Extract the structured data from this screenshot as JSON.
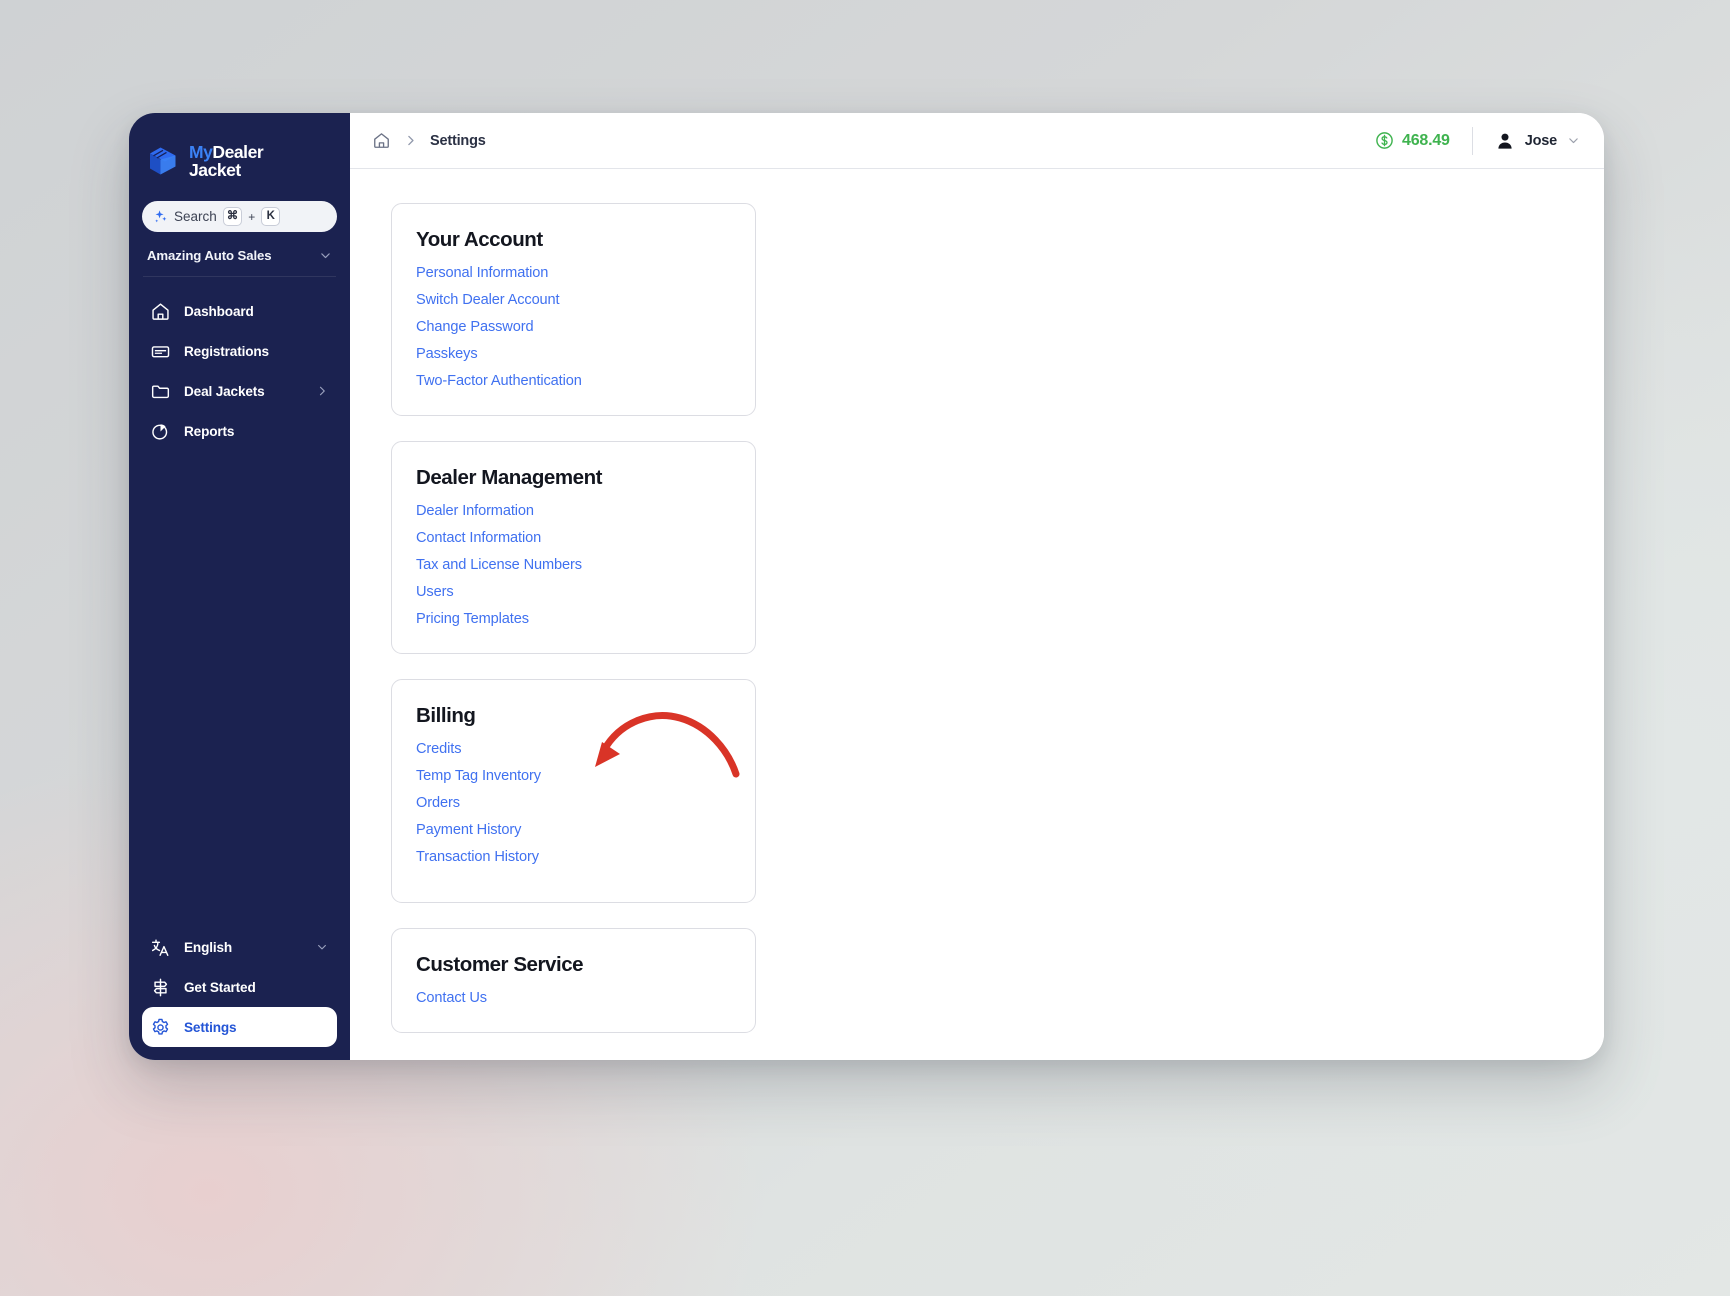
{
  "app": {
    "logo": {
      "line1_accent": "My",
      "line1_rest": "Dealer",
      "line2": "Jacket",
      "icon": "layers-logo-icon"
    },
    "accent_blue": "#4071f0",
    "sidebar_bg": "#1b2250",
    "credit_green": "#3fb34f",
    "annotation_red": "#d93427"
  },
  "sidebar": {
    "search": {
      "label": "Search",
      "key_modifier": "⌘",
      "key_plus": "+",
      "key_letter": "K",
      "icon": "sparkle-icon"
    },
    "dealer_selector": {
      "name": "Amazing Auto Sales",
      "icon": "chevron-down-icon"
    },
    "nav_items": [
      {
        "label": "Dashboard",
        "icon": "home-icon",
        "has_chevron": false,
        "active": false
      },
      {
        "label": "Registrations",
        "icon": "card-icon",
        "has_chevron": false,
        "active": false
      },
      {
        "label": "Deal Jackets",
        "icon": "folder-icon",
        "has_chevron": true,
        "active": false
      },
      {
        "label": "Reports",
        "icon": "pie-chart-icon",
        "has_chevron": false,
        "active": false
      }
    ],
    "bottom_items": [
      {
        "label": "English",
        "icon": "translate-icon",
        "has_chevron": true,
        "active": false
      },
      {
        "label": "Get Started",
        "icon": "signpost-icon",
        "has_chevron": false,
        "active": false
      },
      {
        "label": "Settings",
        "icon": "gear-icon",
        "has_chevron": false,
        "active": true
      }
    ]
  },
  "topbar": {
    "breadcrumb": {
      "home_icon": "home-icon",
      "separator_icon": "chevron-right-icon",
      "current": "Settings"
    },
    "credits": {
      "icon": "dollar-circle-icon",
      "amount": "468.49"
    },
    "user": {
      "icon": "avatar-icon",
      "name": "Jose",
      "chevron_icon": "chevron-down-icon"
    }
  },
  "content": {
    "cards": [
      {
        "title": "Your Account",
        "links": [
          "Personal Information",
          "Switch Dealer Account",
          "Change Password",
          "Passkeys",
          "Two-Factor Authentication"
        ]
      },
      {
        "title": "Dealer Management",
        "links": [
          "Dealer Information",
          "Contact Information",
          "Tax and License Numbers",
          "Users",
          "Pricing Templates"
        ]
      },
      {
        "title": "Billing",
        "links": [
          "Credits",
          "Temp Tag Inventory",
          "Orders",
          "Payment History",
          "Transaction History"
        ],
        "annotation": {
          "type": "curved-arrow",
          "points_to": "Temp Tag Inventory",
          "color": "#d93427"
        }
      },
      {
        "title": "Customer Service",
        "links": [
          "Contact Us"
        ]
      }
    ]
  }
}
